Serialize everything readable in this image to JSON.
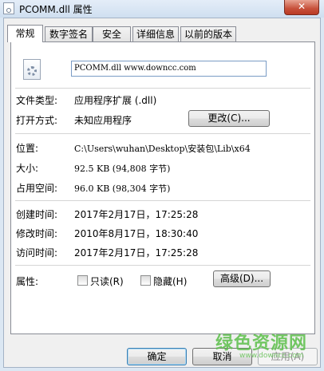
{
  "window": {
    "title": "PCOMM.dll 属性",
    "close_glyph": "✕"
  },
  "tabs": [
    {
      "label": "常规",
      "active": true
    },
    {
      "label": "数字签名",
      "active": false
    },
    {
      "label": "安全",
      "active": false
    },
    {
      "label": "详细信息",
      "active": false
    },
    {
      "label": "以前的版本",
      "active": false
    }
  ],
  "general": {
    "file_name": "PCOMM.dll  www.downcc.com",
    "file_type_label": "文件类型:",
    "file_type_value": "应用程序扩展 (.dll)",
    "open_with_label": "打开方式:",
    "open_with_value": "未知应用程序",
    "change_button": "更改(C)...",
    "location_label": "位置:",
    "location_value": "C:\\Users\\wuhan\\Desktop\\安装包\\Lib\\x64",
    "size_label": "大小:",
    "size_value": "92.5 KB (94,808 字节)",
    "size_on_disk_label": "占用空间:",
    "size_on_disk_value": "96.0 KB (98,304 字节)",
    "created_label": "创建时间:",
    "created_value": "2017年2月17日，17:25:28",
    "modified_label": "修改时间:",
    "modified_value": "2010年8月17日，18:30:40",
    "accessed_label": "访问时间:",
    "accessed_value": "2017年2月17日，17:25:28",
    "attributes_label": "属性:",
    "readonly_label": "只读(R)",
    "hidden_label": "隐藏(H)",
    "advanced_button": "高级(D)..."
  },
  "footer": {
    "ok_button": "确定",
    "cancel_button": "取消",
    "apply_button": "应用(A)"
  },
  "watermark": {
    "text": "绿色资源网",
    "sub": "www.downcc.com"
  }
}
